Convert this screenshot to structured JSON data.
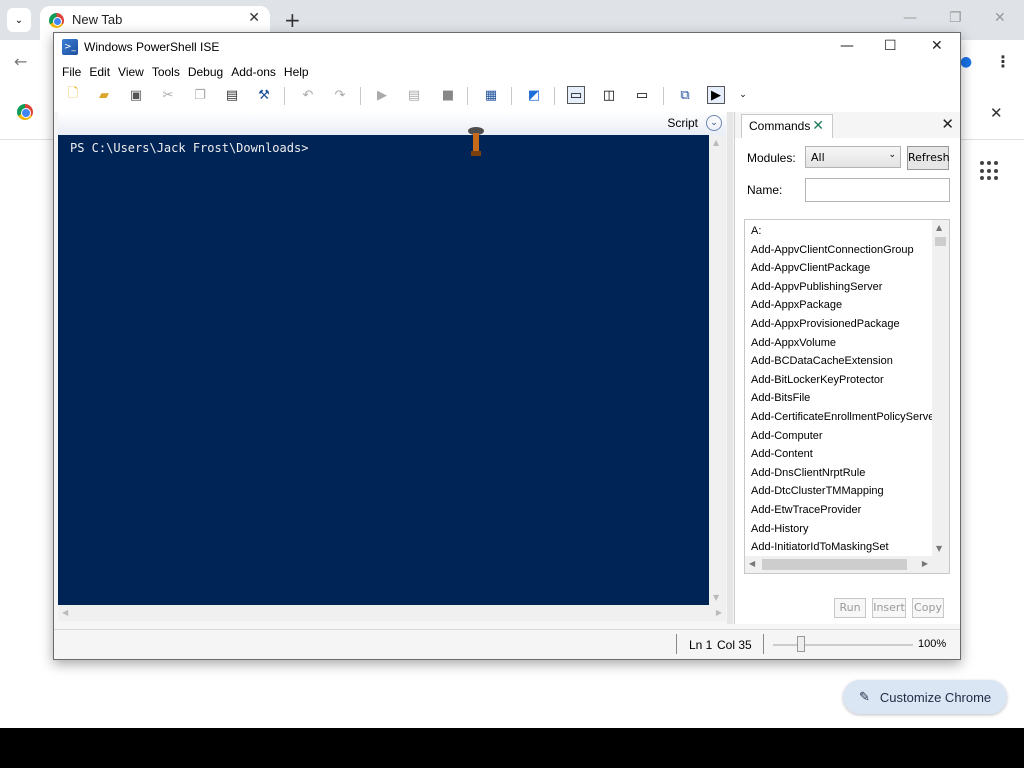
{
  "chrome": {
    "tab_title": "New Tab",
    "tab_close": "✕",
    "new_tab": "+",
    "customize_label": "Customize Chrome",
    "customize_icon": "pencil-icon"
  },
  "ise": {
    "title": "Windows PowerShell ISE",
    "window_controls": {
      "minimize": "—",
      "maximize": "☐",
      "close": "✕"
    },
    "menu": [
      "File",
      "Edit",
      "View",
      "Tools",
      "Debug",
      "Add-ons",
      "Help"
    ],
    "script_label": "Script",
    "script_toggle": "⌄",
    "console_prompt": "PS C:\\Users\\Jack Frost\\Downloads>",
    "colors": {
      "console_bg": "#012456",
      "accent": "#1d4f9a"
    }
  },
  "commands": {
    "tab_label": "Commands",
    "tab_close": "✕",
    "pane_close": "✕",
    "modules_label": "Modules:",
    "modules_value": "All",
    "refresh_label": "Refresh",
    "name_label": "Name:",
    "name_value": "",
    "items": [
      "A:",
      "Add-AppvClientConnectionGroup",
      "Add-AppvClientPackage",
      "Add-AppvPublishingServer",
      "Add-AppxPackage",
      "Add-AppxProvisionedPackage",
      "Add-AppxVolume",
      "Add-BCDataCacheExtension",
      "Add-BitLockerKeyProtector",
      "Add-BitsFile",
      "Add-CertificateEnrollmentPolicyServer",
      "Add-Computer",
      "Add-Content",
      "Add-DnsClientNrptRule",
      "Add-DtcClusterTMMapping",
      "Add-EtwTraceProvider",
      "Add-History",
      "Add-InitiatorIdToMaskingSet"
    ],
    "run_label": "Run",
    "insert_label": "Insert",
    "copy_label": "Copy"
  },
  "status": {
    "line": "Ln 1",
    "col": "Col 35",
    "zoom": "100%",
    "zoom_level": 0.2
  }
}
